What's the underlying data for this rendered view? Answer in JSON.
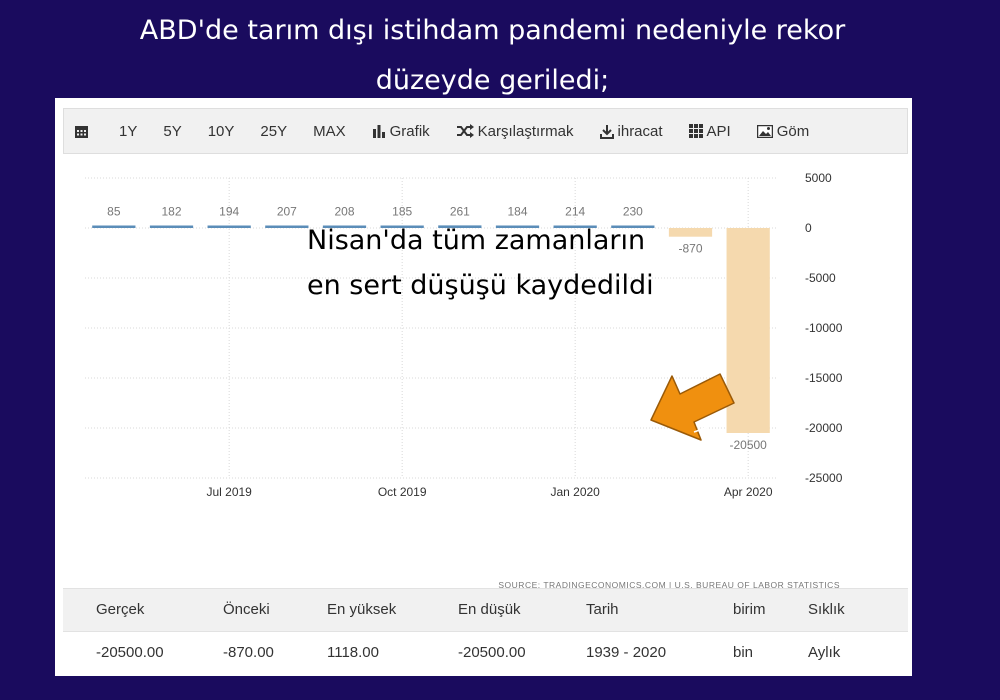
{
  "headline": {
    "line1": "ABD'de tarım dışı istihdam pandemi nedeniyle rekor",
    "line2": "düzeyde geriledi;"
  },
  "toolbar": {
    "range_1y": "1Y",
    "range_5y": "5Y",
    "range_10y": "10Y",
    "range_25y": "25Y",
    "range_max": "MAX",
    "grafik": "Grafik",
    "compare": "Karşılaştırmak",
    "export": "ihracat",
    "api": "API",
    "embed": "Göm"
  },
  "annotation": {
    "line1": "Nisan'da tüm zamanların",
    "line2": "en sert düşüşü kaydedildi"
  },
  "chart_data": {
    "type": "bar",
    "categories": [
      "",
      "",
      "",
      "",
      "",
      "",
      "",
      "",
      "",
      "",
      "",
      ""
    ],
    "values": [
      85,
      182,
      194,
      207,
      208,
      185,
      261,
      184,
      214,
      230,
      -870,
      -20500
    ],
    "data_labels": [
      "85",
      "182",
      "194",
      "207",
      "208",
      "185",
      "261",
      "184",
      "214",
      "230",
      "-870",
      "-20500"
    ],
    "x_tick_labels": [
      "Jul 2019",
      "Oct 2019",
      "Jan 2020",
      "Apr 2020"
    ],
    "x_tick_positions": [
      2.5,
      5.5,
      8.5,
      11.5
    ],
    "y_ticks": [
      5000,
      0,
      -5000,
      -10000,
      -15000,
      -20000,
      -25000
    ],
    "y_tick_labels": [
      "5000",
      "0",
      "-5000",
      "-10000",
      "-15000",
      "-20000",
      "-25000"
    ],
    "ylim": [
      -25000,
      5000
    ],
    "title": "",
    "xlabel": "",
    "ylabel": "",
    "grid": true,
    "positive_color": "#5b8db8",
    "negative_color": "#f5d9ae",
    "source": "SOURCE: TRADINGECONOMICS.COM  |  U.S. BUREAU OF LABOR STATISTICS"
  },
  "table": {
    "headers": [
      "Gerçek",
      "Önceki",
      "En yüksek",
      "En düşük",
      "Tarih",
      "birim",
      "Sıklık"
    ],
    "row": [
      "-20500.00",
      "-870.00",
      "1118.00",
      "-20500.00",
      "1939 - 2020",
      "bin",
      "Aylık"
    ]
  },
  "colors": {
    "background": "#1a0b5e",
    "arrow": "#f0900f"
  }
}
